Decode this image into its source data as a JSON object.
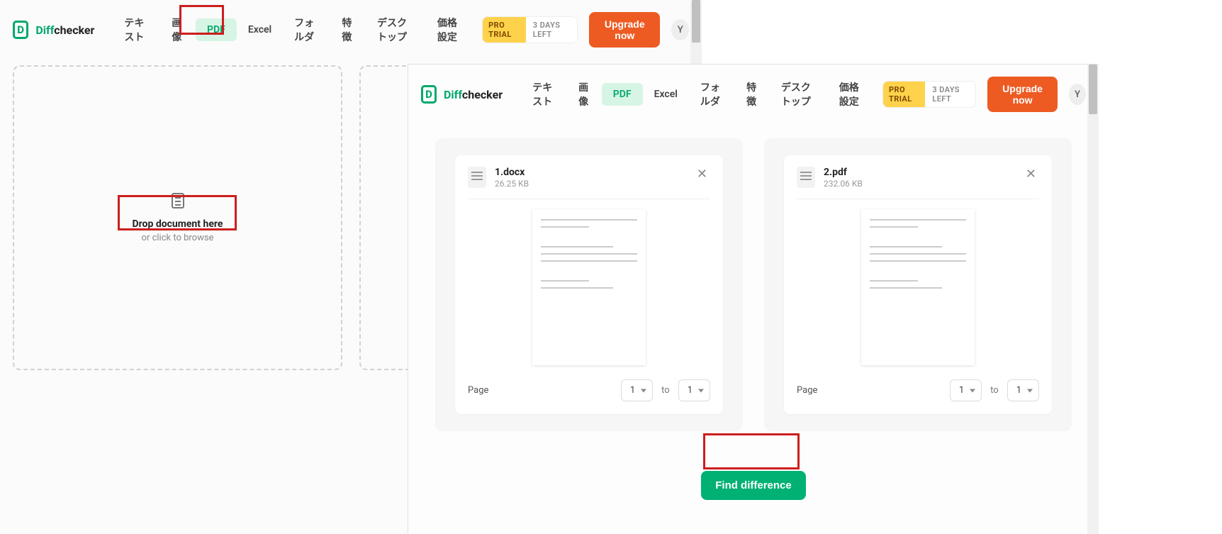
{
  "brand_diff": "Diff",
  "brand_checker": "checker",
  "nav": {
    "text": "テキスト",
    "image": "画像",
    "pdf": "PDF",
    "excel": "Excel",
    "folder": "フォルダ",
    "features": "特徴",
    "desktop": "デスクトップ",
    "pricing": "価格設定"
  },
  "trial": {
    "pro": "PRO TRIAL",
    "days": "3 DAYS LEFT"
  },
  "upgrade": "Upgrade now",
  "avatar": "Y",
  "drop": {
    "title": "Drop document here",
    "sub": "or click to browse"
  },
  "find_disabled": "Find difference",
  "find_primary": "Find difference",
  "files": {
    "a": {
      "name": "1.docx",
      "size": "26.25 KB",
      "page_from": "1",
      "page_to": "1"
    },
    "b": {
      "name": "2.pdf",
      "size": "232.06 KB",
      "page_from": "1",
      "page_to": "1"
    }
  },
  "labels": {
    "page": "Page",
    "to": "to"
  }
}
